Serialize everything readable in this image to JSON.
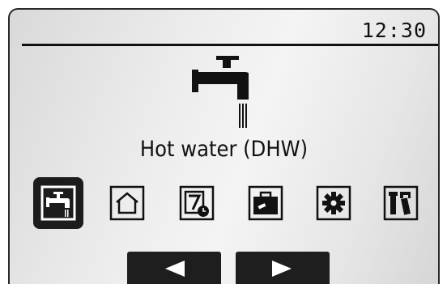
{
  "status_bar": {
    "time": "12:30"
  },
  "main": {
    "hero_icon": "tap-icon",
    "title": "Hot water (DHW)"
  },
  "menu": {
    "items": [
      {
        "icon": "tap-icon",
        "selected": true
      },
      {
        "icon": "house-icon",
        "selected": false
      },
      {
        "icon": "schedule-icon",
        "selected": false
      },
      {
        "icon": "suitcase-icon",
        "selected": false
      },
      {
        "icon": "gear-icon",
        "selected": false
      },
      {
        "icon": "service-tools-icon",
        "selected": false
      }
    ]
  },
  "nav": {
    "left_icon": "arrow-left-icon",
    "right_icon": "arrow-right-icon"
  },
  "colors": {
    "text": "#111111",
    "screen_light": "#f4f4f4",
    "screen_dark": "#d6d6d6",
    "button": "#1e1e1e"
  }
}
